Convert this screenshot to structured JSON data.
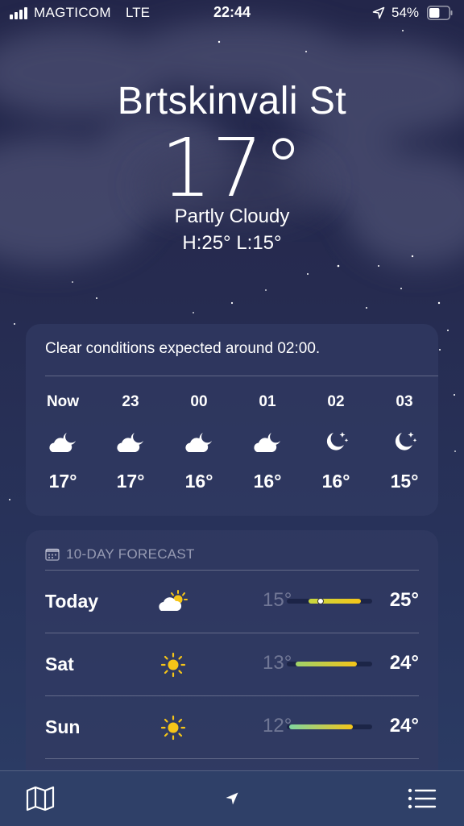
{
  "status": {
    "carrier": "MAGTICOM",
    "network": "LTE",
    "time": "22:44",
    "battery": "54%",
    "battery_level": 0.54
  },
  "location": {
    "city": "Brtskinvali St",
    "temp": "17°",
    "condition": "Partly Cloudy",
    "hi_lo": "H:25°  L:15°"
  },
  "hourly": {
    "summary": "Clear conditions expected around 02:00.",
    "items": [
      {
        "label": "Now",
        "icon": "cloud-moon-icon",
        "temp": "17°"
      },
      {
        "label": "23",
        "icon": "cloud-moon-icon",
        "temp": "17°"
      },
      {
        "label": "00",
        "icon": "cloud-moon-icon",
        "temp": "16°"
      },
      {
        "label": "01",
        "icon": "cloud-moon-icon",
        "temp": "16°"
      },
      {
        "label": "02",
        "icon": "moon-stars-icon",
        "temp": "16°"
      },
      {
        "label": "03",
        "icon": "moon-stars-icon",
        "temp": "15°"
      }
    ]
  },
  "forecast": {
    "title": "10-DAY FORECAST",
    "rows": [
      {
        "day": "Today",
        "icon": "partly-sunny-icon",
        "low": "15°",
        "high": "25°",
        "range_start": 0.25,
        "range_end": 0.87,
        "current": 0.4,
        "gradient": [
          "#c8d840",
          "#f5c518"
        ]
      },
      {
        "day": "Sat",
        "icon": "sun-icon",
        "low": "13°",
        "high": "24°",
        "range_start": 0.1,
        "range_end": 0.82,
        "gradient": [
          "#9fd36a",
          "#f5c518"
        ]
      },
      {
        "day": "Sun",
        "icon": "sun-icon",
        "low": "12°",
        "high": "24°",
        "range_start": 0.03,
        "range_end": 0.77,
        "gradient": [
          "#7fd6a0",
          "#f5c518"
        ]
      }
    ]
  },
  "toolbar": {
    "map_icon": "map-icon",
    "location_icon": "location-arrow-icon",
    "list_icon": "list-icon"
  }
}
